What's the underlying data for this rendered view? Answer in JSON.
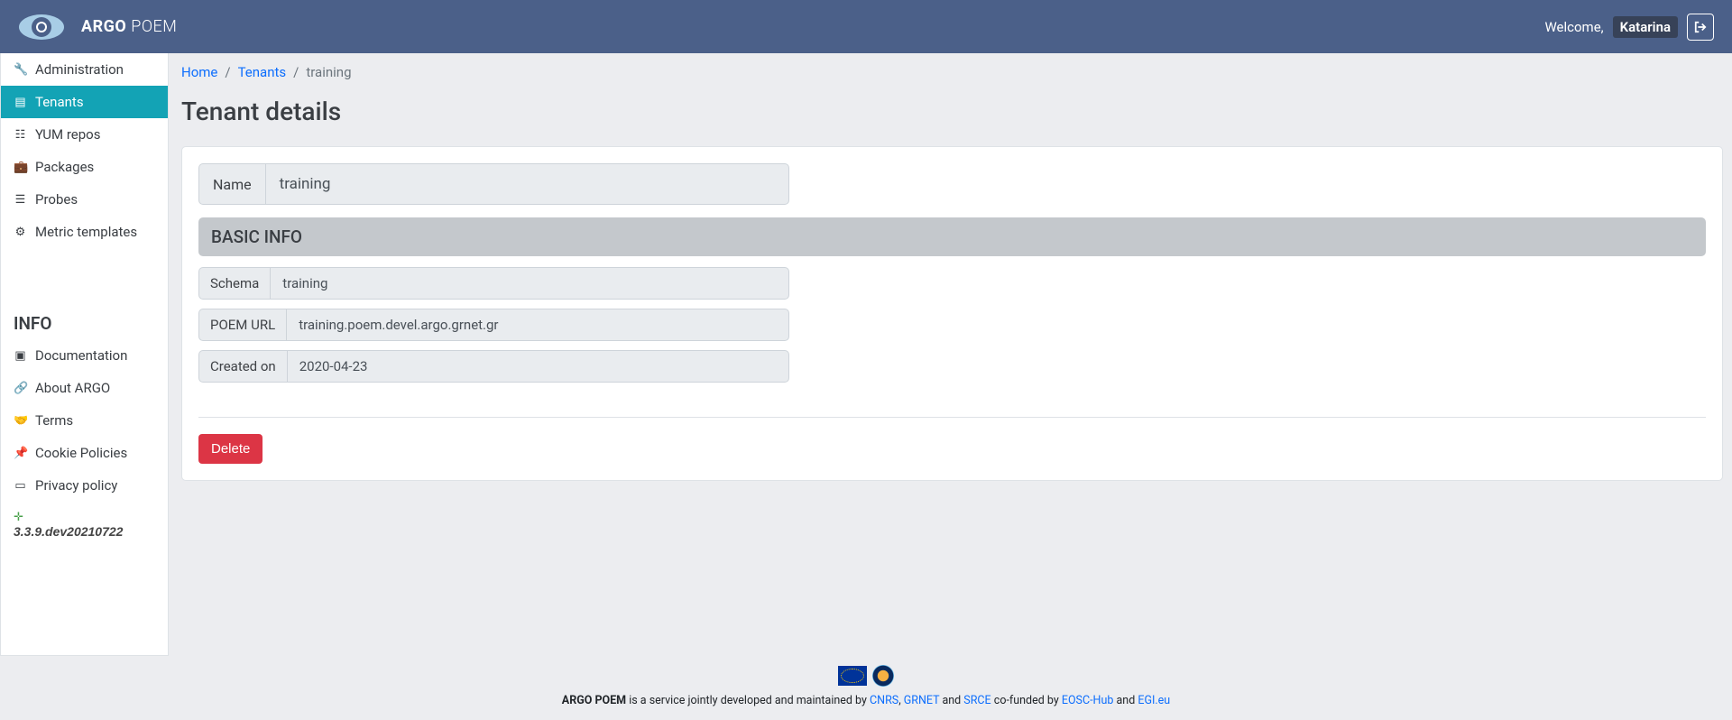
{
  "header": {
    "brand_bold": "ARGO",
    "brand_thin": "POEM",
    "welcome_prefix": "Welcome,",
    "username": "Katarina"
  },
  "sidebar": {
    "nav": [
      {
        "label": "Administration",
        "icon": "wrench"
      },
      {
        "label": "Tenants",
        "icon": "card",
        "active": true
      },
      {
        "label": "YUM repos",
        "icon": "boxes"
      },
      {
        "label": "Packages",
        "icon": "briefcase"
      },
      {
        "label": "Probes",
        "icon": "server"
      },
      {
        "label": "Metric templates",
        "icon": "cog"
      }
    ],
    "info_heading": "INFO",
    "info": [
      {
        "label": "Documentation",
        "icon": "book"
      },
      {
        "label": "About ARGO",
        "icon": "link"
      },
      {
        "label": "Terms",
        "icon": "hands"
      },
      {
        "label": "Cookie Policies",
        "icon": "pin"
      },
      {
        "label": "Privacy policy",
        "icon": "idcard"
      }
    ],
    "version": "3.3.9.dev20210722"
  },
  "breadcrumb": {
    "home": "Home",
    "tenants": "Tenants",
    "current": "training"
  },
  "page": {
    "title": "Tenant details",
    "name_label": "Name",
    "name_value": "training",
    "section_heading": "BASIC INFO",
    "fields": [
      {
        "label": "Schema",
        "value": "training"
      },
      {
        "label": "POEM URL",
        "value": "training.poem.devel.argo.grnet.gr"
      },
      {
        "label": "Created on",
        "value": "2020-04-23"
      }
    ],
    "delete_label": "Delete"
  },
  "footer": {
    "prefix_bold": "ARGO POEM",
    "text1": " is a service jointly developed and maintained by ",
    "cnrs": "CNRS",
    "grnet": "GRNET",
    "and1": " and ",
    "srce": "SRCE",
    "text2": " co-funded by ",
    "eosc": "EOSC-Hub",
    "and2": " and ",
    "egi": "EGI.eu",
    "comma": ", "
  }
}
